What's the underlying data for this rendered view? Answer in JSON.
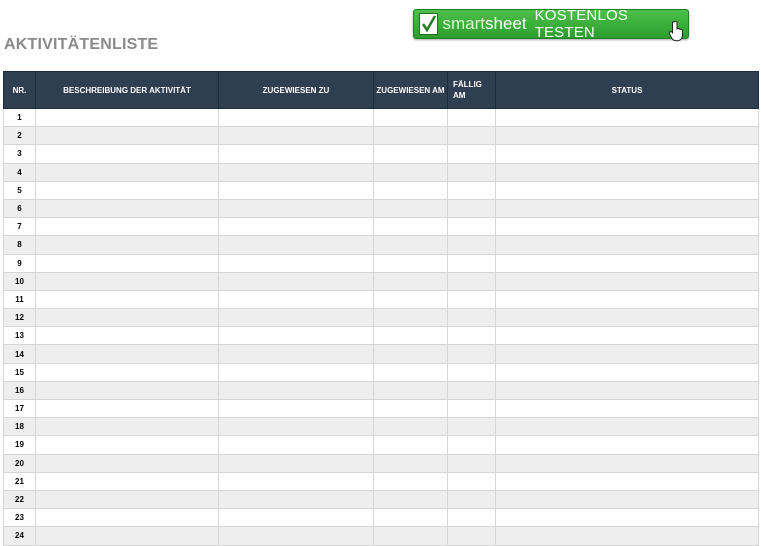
{
  "page": {
    "title": "AKTIVITÄTENLISTE"
  },
  "banner": {
    "brand_part1": "smart",
    "brand_part2": "sheet",
    "cta": "KOSTENLOS TESTEN",
    "check_icon": "checkmark-icon",
    "cursor_icon": "hand-pointer-icon"
  },
  "table": {
    "headers": {
      "nr": "NR.",
      "beschreibung": "BESCHREIBUNG DER AKTIVITÄT",
      "zugewiesen_zu": "ZUGEWIESEN ZU",
      "zugewiesen_am": "ZUGEWIESEN AM",
      "faellig_am": "FÄLLIG AM",
      "status": "STATUS"
    },
    "rows": [
      "1",
      "2",
      "3",
      "4",
      "5",
      "6",
      "7",
      "8",
      "9",
      "10",
      "11",
      "12",
      "13",
      "14",
      "15",
      "16",
      "17",
      "18",
      "19",
      "20",
      "21",
      "22",
      "23",
      "24"
    ]
  },
  "colors": {
    "header_bg": "#2f3e50",
    "banner_green": "#3aae3c",
    "title_gray": "#8a8a8a",
    "stripe": "#eeeeee"
  }
}
